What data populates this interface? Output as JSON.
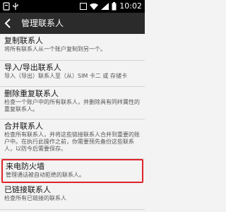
{
  "status_bar": {
    "time": "10:02",
    "icons": [
      "notification-icon",
      "usb-icon",
      "htc-icon",
      "wifi-icon",
      "signal-icon",
      "battery-icon"
    ]
  },
  "header": {
    "title": "管理联系人"
  },
  "items": [
    {
      "title": "复制联系人",
      "subtitle": "将所有联系人从一个账户复制到另一个。"
    },
    {
      "title": "导入/导出联系人",
      "subtitle": "导入（导出）联系人至（从）SIM 卡二 或 存储卡"
    },
    {
      "title": "删除重复联系人",
      "subtitle": "检查一个账户中的所有联系人，并删除具有同样属性的重复联系人。"
    },
    {
      "title": "合并联系人",
      "subtitle": "检查所有联系人，并将这些链接联系人合并到重要的账户中。在执行此操作之前，你需要预先备份这些联系人，以防今后需要保存。"
    },
    {
      "title": "来电防火墙",
      "subtitle": "管理通话被自动拒绝的联系人。"
    },
    {
      "title": "已链接联系人",
      "subtitle": "检查所有已链接的联系人"
    }
  ]
}
